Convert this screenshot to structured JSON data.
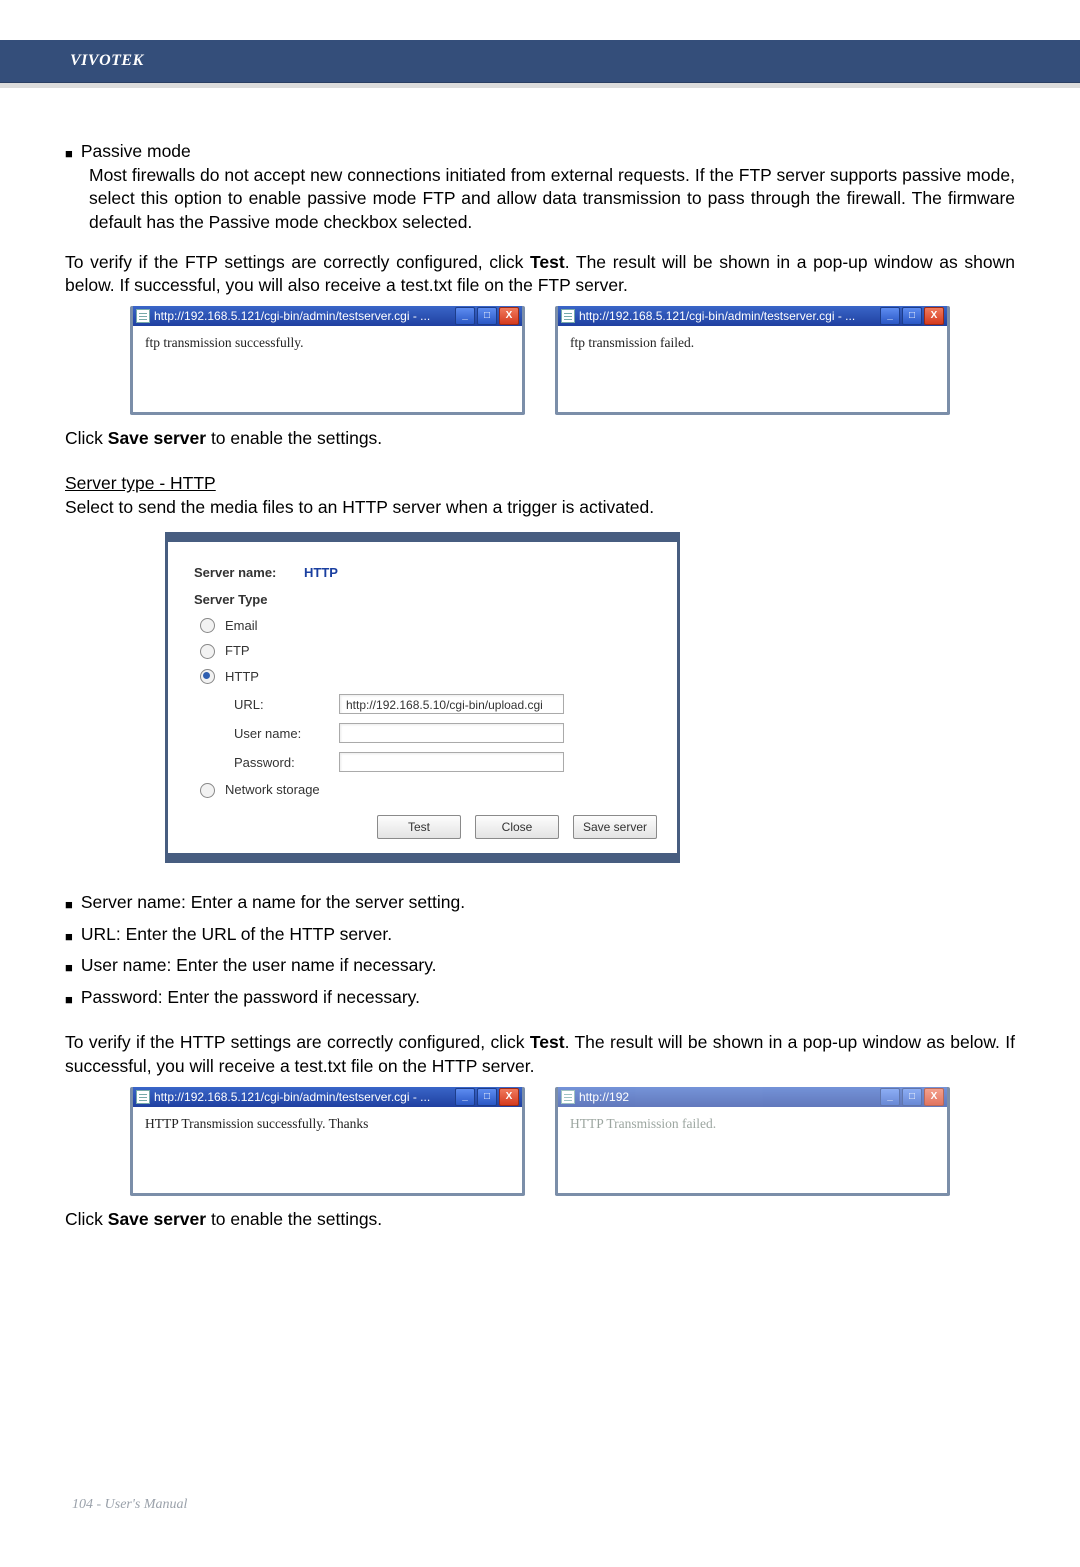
{
  "brand": "VIVOTEK",
  "passive": {
    "title": "Passive mode",
    "desc": "Most firewalls do not accept new connections initiated from external requests. If the FTP server supports passive mode, select this option to enable passive mode FTP and allow data transmission to pass through the firewall. The firmware default has the Passive mode checkbox selected."
  },
  "ftp_verify_para_pre": "To verify if the FTP settings are correctly configured, click ",
  "ftp_verify_test_word": "Test",
  "ftp_verify_para_post": ". The result will be shown in a pop-up window as shown below. If successful, you will also receive a test.txt file on the FTP server.",
  "popup_ftp_ok": {
    "title": "http://192.168.5.121/cgi-bin/admin/testserver.cgi - ...",
    "body": "ftp transmission successfully."
  },
  "popup_ftp_fail": {
    "title": "http://192.168.5.121/cgi-bin/admin/testserver.cgi - ...",
    "body": "ftp transmission failed."
  },
  "click_save_server_pre": "Click ",
  "click_save_server_bold": "Save server",
  "click_save_server_post": " to enable the settings.",
  "http_section": {
    "heading": "Server type - HTTP",
    "desc": "Select to send the media files to an HTTP server when a trigger is activated."
  },
  "panel": {
    "server_name_label": "Server name:",
    "server_name_value": "HTTP",
    "server_type_label": "Server Type",
    "opts": {
      "email": "Email",
      "ftp": "FTP",
      "http": "HTTP",
      "netstore": "Network storage"
    },
    "fields": {
      "url_label": "URL:",
      "url_value": "http://192.168.5.10/cgi-bin/upload.cgi",
      "user_label": "User name:",
      "user_value": "",
      "pass_label": "Password:",
      "pass_value": ""
    },
    "buttons": {
      "test": "Test",
      "close": "Close",
      "save": "Save server"
    }
  },
  "bullets": {
    "server_name": "Server name: Enter a name for the server setting.",
    "url": "URL: Enter the URL of the HTTP server.",
    "user": "User name: Enter the user name if necessary.",
    "pass": "Password: Enter the password if necessary."
  },
  "http_verify_para_pre": "To verify if the HTTP settings are correctly configured, click ",
  "http_verify_test_word": "Test",
  "http_verify_para_post": ". The result will be shown in a pop-up window as below. If successful, you will receive a test.txt file on the HTTP server.",
  "popup_http_ok": {
    "title": "http://192.168.5.121/cgi-bin/admin/testserver.cgi - ...",
    "body": "HTTP Transmission successfully. Thanks"
  },
  "popup_http_fail": {
    "title": "http://192",
    "body": "HTTP Transmission failed."
  },
  "footer": "104 - User's Manual",
  "winbtn": {
    "min": "_",
    "max": "□",
    "close": "X"
  }
}
